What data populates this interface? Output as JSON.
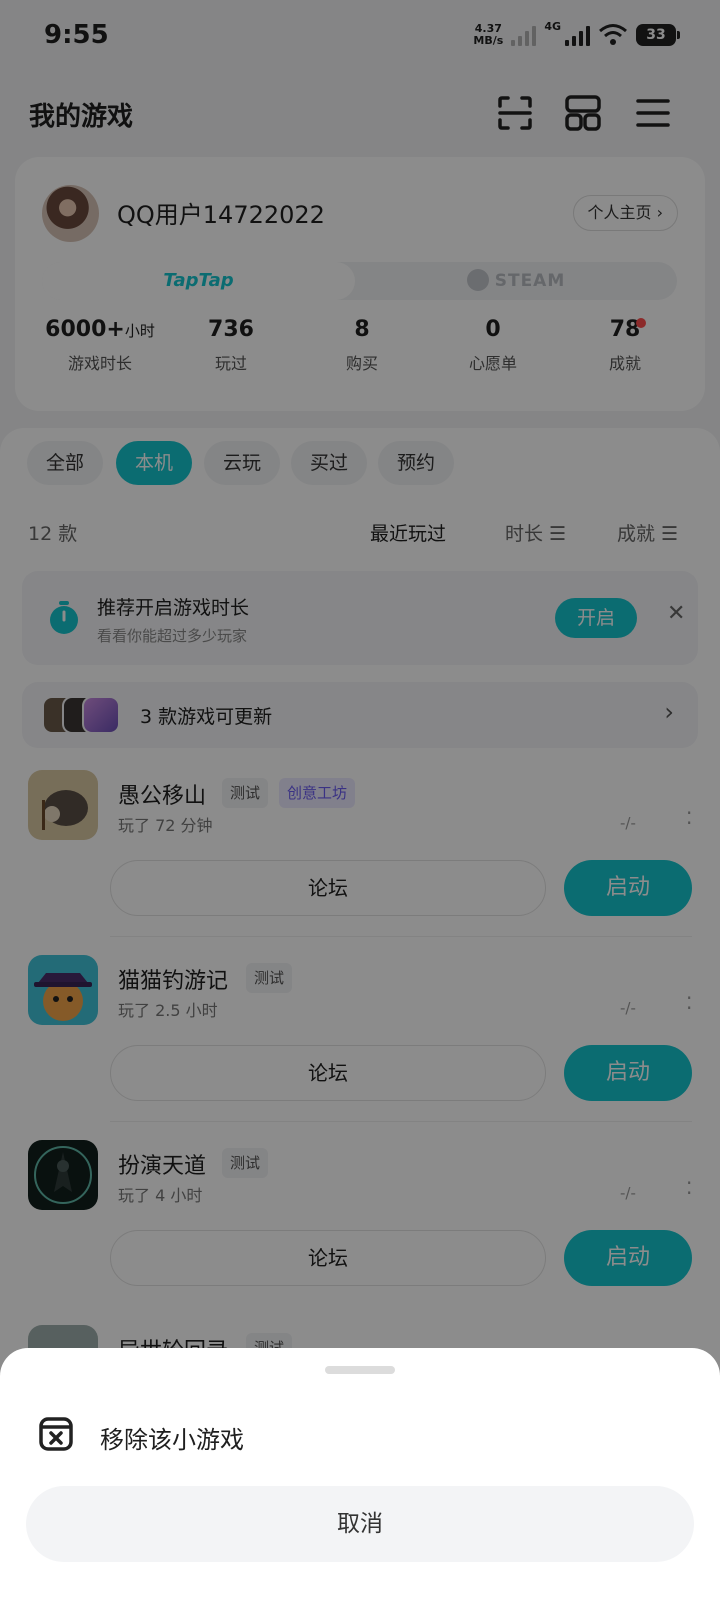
{
  "status_bar": {
    "time": "9:55",
    "net_speed": "4.37",
    "net_speed_unit": "MB/s",
    "network": "4G",
    "battery": "33"
  },
  "header": {
    "title": "我的游戏",
    "icons": [
      "scan-icon",
      "grid-icon",
      "menu-icon"
    ]
  },
  "profile": {
    "username": "QQ用户14722022",
    "homepage_label": "个人主页 ›",
    "platforms": [
      "TapTap",
      "STEAM"
    ],
    "stats": [
      {
        "value": "6000+",
        "unit": "小时",
        "label": "游戏时长"
      },
      {
        "value": "736",
        "unit": "",
        "label": "玩过"
      },
      {
        "value": "8",
        "unit": "",
        "label": "购买"
      },
      {
        "value": "0",
        "unit": "",
        "label": "心愿单"
      },
      {
        "value": "78",
        "unit": "",
        "label": "成就"
      }
    ]
  },
  "filters": {
    "chips": [
      "全部",
      "本机",
      "云玩",
      "买过",
      "预约"
    ],
    "active": "本机"
  },
  "list_meta": {
    "count": "12 款",
    "sorts": [
      "最近玩过",
      "时长 ☰",
      "成就 ☰"
    ]
  },
  "recommend": {
    "title": "推荐开启游戏时长",
    "subtitle": "看看你能超过多少玩家",
    "button": "开启",
    "close": "✕"
  },
  "updates": {
    "text": "3 款游戏可更新",
    "chevron": "›"
  },
  "games": [
    {
      "name": "愚公移山",
      "tags": [
        "测试",
        "创意工坊"
      ],
      "playtime": "玩了 72 分钟",
      "rating": "-/-",
      "forum": "论坛",
      "launch": "启动"
    },
    {
      "name": "猫猫钓游记",
      "tags": [
        "测试"
      ],
      "playtime": "玩了 2.5 小时",
      "rating": "-/-",
      "forum": "论坛",
      "launch": "启动"
    },
    {
      "name": "扮演天道",
      "tags": [
        "测试"
      ],
      "playtime": "玩了 4 小时",
      "rating": "-/-",
      "forum": "论坛",
      "launch": "启动"
    },
    {
      "name": "异世轮回录",
      "tags": [
        "测试"
      ],
      "playtime": "",
      "rating": "",
      "forum": "",
      "launch": ""
    }
  ],
  "sheet": {
    "remove_label": "移除该小游戏",
    "cancel_label": "取消"
  },
  "colors": {
    "accent": "#15c5ce",
    "workshop": "#6b5cf0",
    "overlay": "rgba(0,0,0,0.45)"
  }
}
